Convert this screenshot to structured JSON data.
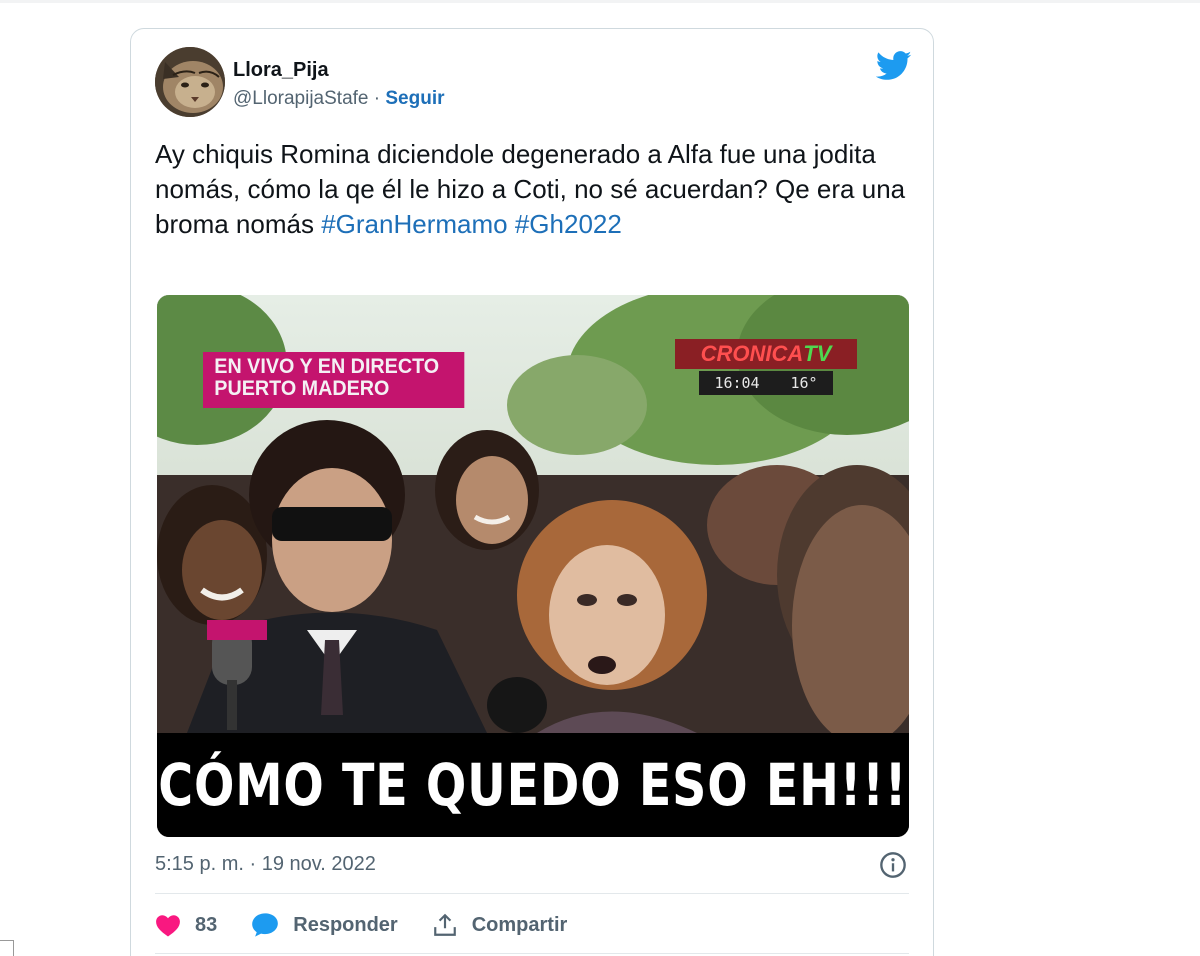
{
  "tweet": {
    "author_name": "Llora_Pija",
    "author_handle": "@LlorapijaStafe",
    "separator": "·",
    "follow_label": "Seguir",
    "text_plain": "Ay chiquis Romina diciendole degenerado a Alfa fue una jodita nomás, cómo la qe él le hizo a Coti, no sé acuerdan? Qe era una broma nomás",
    "hashtags": [
      "#GranHermamo",
      "#Gh2022"
    ],
    "media": {
      "overlay_line1": "EN VIVO Y EN DIRECTO",
      "overlay_line2": "PUERTO MADERO",
      "channel_name_red": "CRONICA",
      "channel_name_green": "TV",
      "channel_time": "16:04",
      "channel_temp": "16°",
      "caption": "CÓMO TE QUEDO ESO EH!!!"
    },
    "timestamp": "5:15 p. m. · 19 nov. 2022",
    "like_count": "83",
    "reply_label": "Responder",
    "share_label": "Compartir"
  },
  "colors": {
    "link": "#1d6fb8",
    "twitter_blue": "#1d9bf0",
    "like_pink": "#f91880",
    "text_primary": "#0f1419",
    "text_secondary": "#536471"
  },
  "icons": {
    "brand": "twitter-bird-icon",
    "info": "info-icon",
    "like": "heart-icon",
    "reply": "speech-bubble-icon",
    "share": "share-upload-icon"
  }
}
